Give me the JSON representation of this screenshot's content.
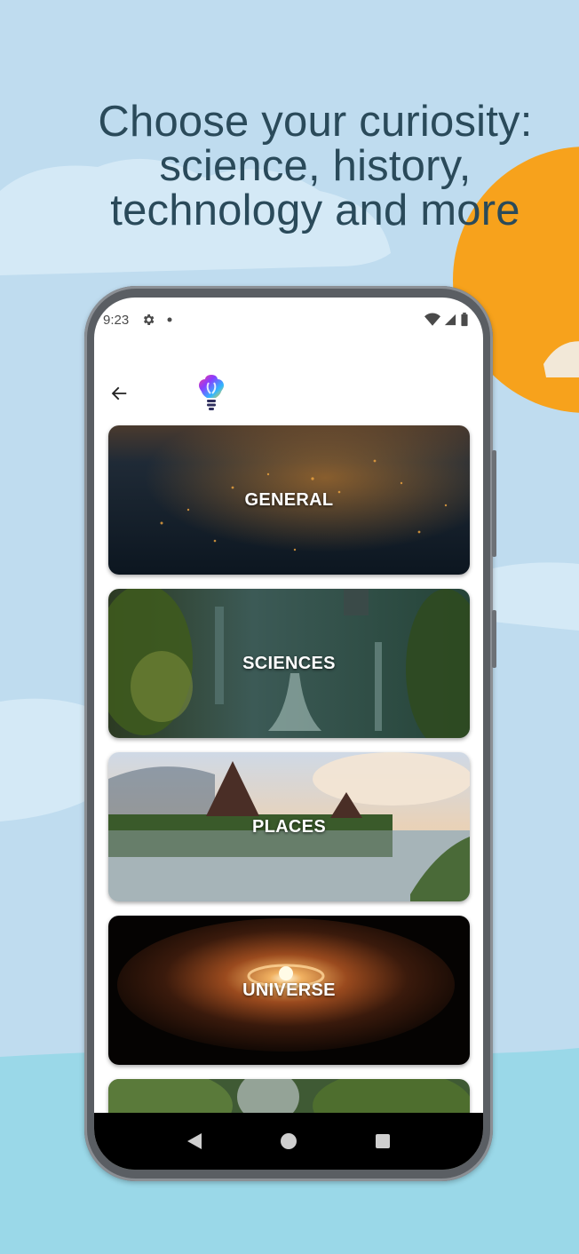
{
  "headline": {
    "line1": "Choose your curiosity:",
    "line2": "science, history,",
    "line3": "technology and more"
  },
  "colors": {
    "background": "#bfdcef",
    "sun": "#f7a21c",
    "headline": "#2a4a5a",
    "cloud": "#d4e9f6",
    "sea": "#9ad8e8"
  },
  "status_bar": {
    "time": "9:23",
    "icons": [
      "settings-icon",
      "notification-dot-icon",
      "wifi-icon",
      "signal-icon",
      "battery-icon"
    ]
  },
  "app_bar": {
    "back_icon": "arrow-left-icon",
    "logo": "lightbulb-logo-icon"
  },
  "categories": [
    {
      "label": "GENERAL"
    },
    {
      "label": "SCIENCES"
    },
    {
      "label": "PLACES"
    },
    {
      "label": "UNIVERSE"
    }
  ],
  "nav_bar": {
    "icons": [
      "back-triangle-icon",
      "home-circle-icon",
      "recents-square-icon"
    ]
  }
}
